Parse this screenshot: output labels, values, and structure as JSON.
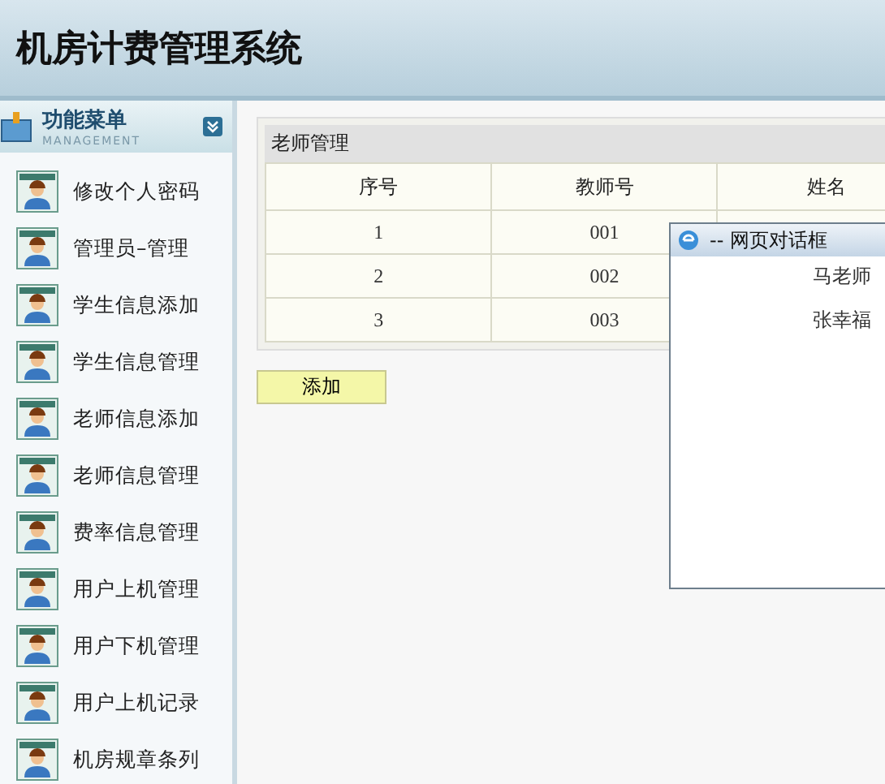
{
  "header": {
    "title": "机房计费管理系统"
  },
  "sidebar": {
    "title": "功能菜单",
    "subtitle": "MANAGEMENT",
    "items": [
      {
        "label": "修改个人密码"
      },
      {
        "label": "管理员–管理"
      },
      {
        "label": "学生信息添加"
      },
      {
        "label": "学生信息管理"
      },
      {
        "label": "老师信息添加"
      },
      {
        "label": "老师信息管理"
      },
      {
        "label": "费率信息管理"
      },
      {
        "label": "用户上机管理"
      },
      {
        "label": "用户下机管理"
      },
      {
        "label": "用户上机记录"
      },
      {
        "label": "机房规章条列"
      }
    ]
  },
  "panel": {
    "title": "老师管理",
    "columns": [
      "序号",
      "教师号",
      "姓名"
    ],
    "rows": [
      {
        "index": "1",
        "teacher_no": "001"
      },
      {
        "index": "2",
        "teacher_no": "002",
        "name": "马老师"
      },
      {
        "index": "3",
        "teacher_no": "003",
        "name": "张幸福"
      }
    ],
    "add_button": "添加"
  },
  "dialog": {
    "title": "-- 网页对话框"
  }
}
